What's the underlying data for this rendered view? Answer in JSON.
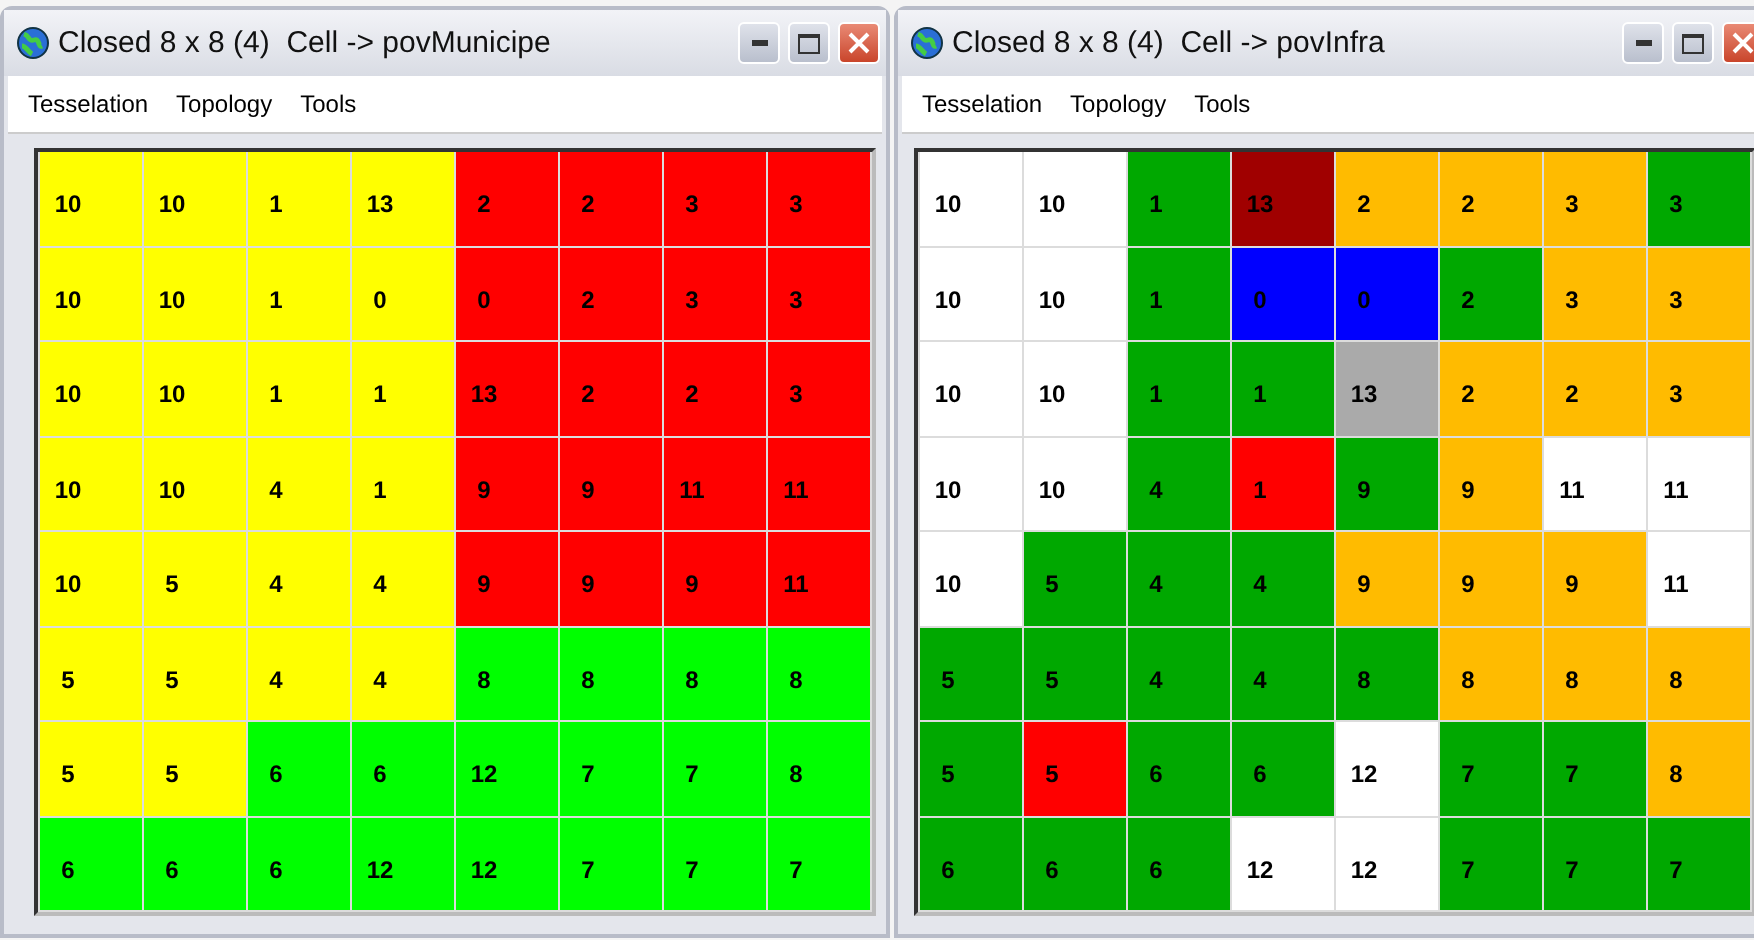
{
  "windows": [
    {
      "title": "Closed 8 x 8 (4)  Cell -> povMunicipe",
      "menu": [
        "Tesselation",
        "Topology",
        "Tools"
      ],
      "grid": [
        {
          "cells": [
            {
              "value": "10",
              "color": "#ffff00"
            },
            {
              "value": "10",
              "color": "#ffff00"
            },
            {
              "value": "1",
              "color": "#ffff00"
            },
            {
              "value": "13",
              "color": "#ffff00"
            },
            {
              "value": "2",
              "color": "#ff0000"
            },
            {
              "value": "2",
              "color": "#ff0000"
            },
            {
              "value": "3",
              "color": "#ff0000"
            },
            {
              "value": "3",
              "color": "#ff0000"
            }
          ]
        },
        {
          "cells": [
            {
              "value": "10",
              "color": "#ffff00"
            },
            {
              "value": "10",
              "color": "#ffff00"
            },
            {
              "value": "1",
              "color": "#ffff00"
            },
            {
              "value": "0",
              "color": "#ffff00"
            },
            {
              "value": "0",
              "color": "#ff0000"
            },
            {
              "value": "2",
              "color": "#ff0000"
            },
            {
              "value": "3",
              "color": "#ff0000"
            },
            {
              "value": "3",
              "color": "#ff0000"
            }
          ]
        },
        {
          "cells": [
            {
              "value": "10",
              "color": "#ffff00"
            },
            {
              "value": "10",
              "color": "#ffff00"
            },
            {
              "value": "1",
              "color": "#ffff00"
            },
            {
              "value": "1",
              "color": "#ffff00"
            },
            {
              "value": "13",
              "color": "#ff0000"
            },
            {
              "value": "2",
              "color": "#ff0000"
            },
            {
              "value": "2",
              "color": "#ff0000"
            },
            {
              "value": "3",
              "color": "#ff0000"
            }
          ]
        },
        {
          "cells": [
            {
              "value": "10",
              "color": "#ffff00"
            },
            {
              "value": "10",
              "color": "#ffff00"
            },
            {
              "value": "4",
              "color": "#ffff00"
            },
            {
              "value": "1",
              "color": "#ffff00"
            },
            {
              "value": "9",
              "color": "#ff0000"
            },
            {
              "value": "9",
              "color": "#ff0000"
            },
            {
              "value": "11",
              "color": "#ff0000"
            },
            {
              "value": "11",
              "color": "#ff0000"
            }
          ]
        },
        {
          "cells": [
            {
              "value": "10",
              "color": "#ffff00"
            },
            {
              "value": "5",
              "color": "#ffff00"
            },
            {
              "value": "4",
              "color": "#ffff00"
            },
            {
              "value": "4",
              "color": "#ffff00"
            },
            {
              "value": "9",
              "color": "#ff0000"
            },
            {
              "value": "9",
              "color": "#ff0000"
            },
            {
              "value": "9",
              "color": "#ff0000"
            },
            {
              "value": "11",
              "color": "#ff0000"
            }
          ]
        },
        {
          "cells": [
            {
              "value": "5",
              "color": "#ffff00"
            },
            {
              "value": "5",
              "color": "#ffff00"
            },
            {
              "value": "4",
              "color": "#ffff00"
            },
            {
              "value": "4",
              "color": "#ffff00"
            },
            {
              "value": "8",
              "color": "#00ff00"
            },
            {
              "value": "8",
              "color": "#00ff00"
            },
            {
              "value": "8",
              "color": "#00ff00"
            },
            {
              "value": "8",
              "color": "#00ff00"
            }
          ]
        },
        {
          "cells": [
            {
              "value": "5",
              "color": "#ffff00"
            },
            {
              "value": "5",
              "color": "#ffff00"
            },
            {
              "value": "6",
              "color": "#00ff00"
            },
            {
              "value": "6",
              "color": "#00ff00"
            },
            {
              "value": "12",
              "color": "#00ff00"
            },
            {
              "value": "7",
              "color": "#00ff00"
            },
            {
              "value": "7",
              "color": "#00ff00"
            },
            {
              "value": "8",
              "color": "#00ff00"
            }
          ]
        },
        {
          "cells": [
            {
              "value": "6",
              "color": "#00ff00"
            },
            {
              "value": "6",
              "color": "#00ff00"
            },
            {
              "value": "6",
              "color": "#00ff00"
            },
            {
              "value": "12",
              "color": "#00ff00"
            },
            {
              "value": "12",
              "color": "#00ff00"
            },
            {
              "value": "7",
              "color": "#00ff00"
            },
            {
              "value": "7",
              "color": "#00ff00"
            },
            {
              "value": "7",
              "color": "#00ff00"
            }
          ]
        }
      ]
    },
    {
      "title": "Closed 8 x 8 (4)  Cell -> povInfra",
      "menu": [
        "Tesselation",
        "Topology",
        "Tools"
      ],
      "grid": [
        {
          "cells": [
            {
              "value": "10",
              "color": "#ffffff"
            },
            {
              "value": "10",
              "color": "#ffffff"
            },
            {
              "value": "1",
              "color": "#00a800"
            },
            {
              "value": "13",
              "color": "#a00000"
            },
            {
              "value": "2",
              "color": "#ffbb00"
            },
            {
              "value": "2",
              "color": "#ffbb00"
            },
            {
              "value": "3",
              "color": "#ffbb00"
            },
            {
              "value": "3",
              "color": "#00a800"
            }
          ]
        },
        {
          "cells": [
            {
              "value": "10",
              "color": "#ffffff"
            },
            {
              "value": "10",
              "color": "#ffffff"
            },
            {
              "value": "1",
              "color": "#00a800"
            },
            {
              "value": "0",
              "color": "#0000ff"
            },
            {
              "value": "0",
              "color": "#0000ff"
            },
            {
              "value": "2",
              "color": "#00a800"
            },
            {
              "value": "3",
              "color": "#ffbb00"
            },
            {
              "value": "3",
              "color": "#ffbb00"
            }
          ]
        },
        {
          "cells": [
            {
              "value": "10",
              "color": "#ffffff"
            },
            {
              "value": "10",
              "color": "#ffffff"
            },
            {
              "value": "1",
              "color": "#00a800"
            },
            {
              "value": "1",
              "color": "#00a800"
            },
            {
              "value": "13",
              "color": "#aaaaaa"
            },
            {
              "value": "2",
              "color": "#ffbb00"
            },
            {
              "value": "2",
              "color": "#ffbb00"
            },
            {
              "value": "3",
              "color": "#ffbb00"
            }
          ]
        },
        {
          "cells": [
            {
              "value": "10",
              "color": "#ffffff"
            },
            {
              "value": "10",
              "color": "#ffffff"
            },
            {
              "value": "4",
              "color": "#00a800"
            },
            {
              "value": "1",
              "color": "#ff0000"
            },
            {
              "value": "9",
              "color": "#00a800"
            },
            {
              "value": "9",
              "color": "#ffbb00"
            },
            {
              "value": "11",
              "color": "#ffffff"
            },
            {
              "value": "11",
              "color": "#ffffff"
            }
          ]
        },
        {
          "cells": [
            {
              "value": "10",
              "color": "#ffffff"
            },
            {
              "value": "5",
              "color": "#00a800"
            },
            {
              "value": "4",
              "color": "#00a800"
            },
            {
              "value": "4",
              "color": "#00a800"
            },
            {
              "value": "9",
              "color": "#ffbb00"
            },
            {
              "value": "9",
              "color": "#ffbb00"
            },
            {
              "value": "9",
              "color": "#ffbb00"
            },
            {
              "value": "11",
              "color": "#ffffff"
            }
          ]
        },
        {
          "cells": [
            {
              "value": "5",
              "color": "#00a800"
            },
            {
              "value": "5",
              "color": "#00a800"
            },
            {
              "value": "4",
              "color": "#00a800"
            },
            {
              "value": "4",
              "color": "#00a800"
            },
            {
              "value": "8",
              "color": "#00a800"
            },
            {
              "value": "8",
              "color": "#ffbb00"
            },
            {
              "value": "8",
              "color": "#ffbb00"
            },
            {
              "value": "8",
              "color": "#ffbb00"
            }
          ]
        },
        {
          "cells": [
            {
              "value": "5",
              "color": "#00a800"
            },
            {
              "value": "5",
              "color": "#ff0000"
            },
            {
              "value": "6",
              "color": "#00a800"
            },
            {
              "value": "6",
              "color": "#00a800"
            },
            {
              "value": "12",
              "color": "#ffffff"
            },
            {
              "value": "7",
              "color": "#00a800"
            },
            {
              "value": "7",
              "color": "#00a800"
            },
            {
              "value": "8",
              "color": "#ffbb00"
            }
          ]
        },
        {
          "cells": [
            {
              "value": "6",
              "color": "#00a800"
            },
            {
              "value": "6",
              "color": "#00a800"
            },
            {
              "value": "6",
              "color": "#00a800"
            },
            {
              "value": "12",
              "color": "#ffffff"
            },
            {
              "value": "12",
              "color": "#ffffff"
            },
            {
              "value": "7",
              "color": "#00a800"
            },
            {
              "value": "7",
              "color": "#00a800"
            },
            {
              "value": "7",
              "color": "#00a800"
            }
          ]
        }
      ]
    }
  ]
}
